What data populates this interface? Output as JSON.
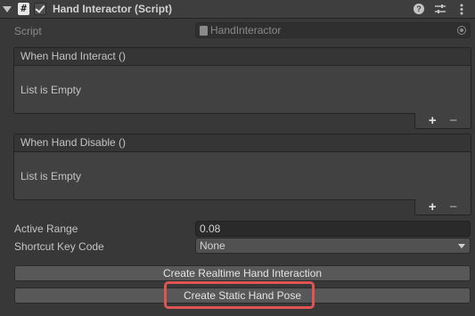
{
  "header": {
    "title": "Hand Interactor (Script)",
    "icons": [
      "foldout-arrow",
      "script-icon",
      "enable-checkbox",
      "help-icon",
      "preset-icon",
      "more-icon"
    ],
    "enabled": true
  },
  "script": {
    "label": "Script",
    "value": "HandInteractor"
  },
  "events": [
    {
      "title": "When Hand Interact ()",
      "empty_text": "List is Empty"
    },
    {
      "title": "When Hand Disable ()",
      "empty_text": "List is Empty"
    }
  ],
  "list_controls": {
    "add": "+",
    "remove": "−"
  },
  "active_range": {
    "label": "Active Range",
    "value": "0.08"
  },
  "shortcut": {
    "label": "Shortcut Key Code",
    "value": "None"
  },
  "buttons": {
    "realtime": "Create Realtime Hand Interaction",
    "static": "Create Static Hand Pose"
  },
  "colors": {
    "highlight": "#e05454",
    "background": "#383838"
  }
}
